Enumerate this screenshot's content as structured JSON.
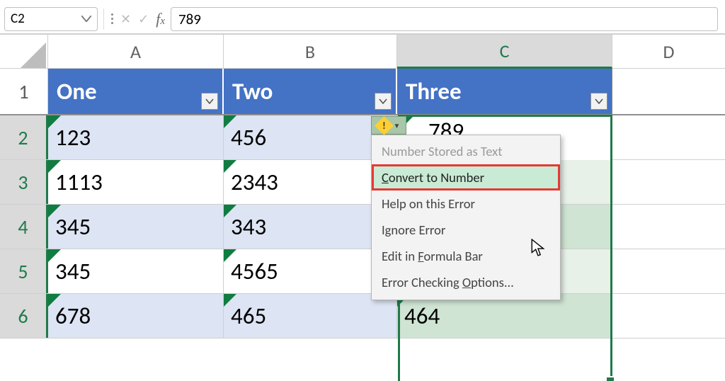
{
  "name_box": {
    "value": "C2"
  },
  "formula_bar": {
    "value": "789"
  },
  "columns": [
    "A",
    "B",
    "C",
    "D"
  ],
  "rows": {
    "r1": {
      "num": "1",
      "A": "One",
      "B": "Two",
      "C": "Three"
    },
    "r2": {
      "num": "2",
      "A": "123",
      "B": "456",
      "C": "789"
    },
    "r3": {
      "num": "3",
      "A": "1113",
      "B": "2343"
    },
    "r4": {
      "num": "4",
      "A": "345",
      "B": "343"
    },
    "r5": {
      "num": "5",
      "A": "345",
      "B": "4565"
    },
    "r6": {
      "num": "6",
      "A": "678",
      "B": "465",
      "C": "464"
    }
  },
  "smart_tag": {
    "icon_label": "!"
  },
  "ctx": {
    "i0": "Number Stored as Text",
    "i1_pre": "C",
    "i1_post": "onvert to Number",
    "i2": "Help on this Error",
    "i3": "Ignore Error",
    "i4_pre": "Edit in ",
    "i4_u": "F",
    "i4_post": "ormula Bar",
    "i5_pre": "Error Checking ",
    "i5_u": "O",
    "i5_post": "ptions..."
  }
}
